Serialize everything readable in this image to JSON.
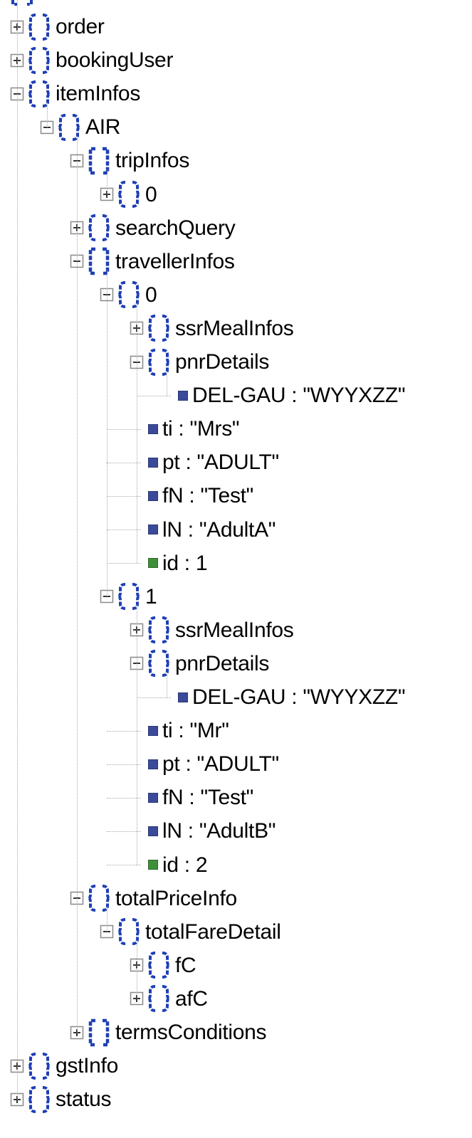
{
  "colors": {
    "bracket": "#1f3fb5",
    "string_leaf": "#3a4a9a",
    "number_leaf": "#3f8f3a",
    "toggle_border": "#8a8a8a",
    "guide_line": "#a9a9a9"
  },
  "nodes": [
    {
      "label": "order",
      "type": "object",
      "toggle": "plus",
      "depth": 0
    },
    {
      "label": "bookingUser",
      "type": "object",
      "toggle": "plus",
      "depth": 0
    },
    {
      "label": "itemInfos",
      "type": "object",
      "toggle": "minus",
      "depth": 0
    },
    {
      "label": "AIR",
      "type": "object",
      "toggle": "minus",
      "depth": 1
    },
    {
      "label": "tripInfos",
      "type": "array",
      "toggle": "minus",
      "depth": 2
    },
    {
      "label": "0",
      "type": "object",
      "toggle": "plus",
      "depth": 3
    },
    {
      "label": "searchQuery",
      "type": "object",
      "toggle": "plus",
      "depth": 2
    },
    {
      "label": "travellerInfos",
      "type": "array",
      "toggle": "minus",
      "depth": 2
    },
    {
      "label": "0",
      "type": "object",
      "toggle": "minus",
      "depth": 3
    },
    {
      "label": "ssrMealInfos",
      "type": "object",
      "toggle": "plus",
      "depth": 4
    },
    {
      "label": "pnrDetails",
      "type": "object",
      "toggle": "minus",
      "depth": 4
    },
    {
      "label": "DEL-GAU : \"WYYXZZ\"",
      "type": "string",
      "depth": 5
    },
    {
      "label": "ti : \"Mrs\"",
      "type": "string",
      "depth": 4
    },
    {
      "label": "pt : \"ADULT\"",
      "type": "string",
      "depth": 4
    },
    {
      "label": "fN : \"Test\"",
      "type": "string",
      "depth": 4
    },
    {
      "label": "lN : \"AdultA\"",
      "type": "string",
      "depth": 4
    },
    {
      "label": "id : 1",
      "type": "number",
      "depth": 4
    },
    {
      "label": "1",
      "type": "object",
      "toggle": "minus",
      "depth": 3
    },
    {
      "label": "ssrMealInfos",
      "type": "object",
      "toggle": "plus",
      "depth": 4
    },
    {
      "label": "pnrDetails",
      "type": "object",
      "toggle": "minus",
      "depth": 4
    },
    {
      "label": "DEL-GAU : \"WYYXZZ\"",
      "type": "string",
      "depth": 5
    },
    {
      "label": "ti : \"Mr\"",
      "type": "string",
      "depth": 4
    },
    {
      "label": "pt : \"ADULT\"",
      "type": "string",
      "depth": 4
    },
    {
      "label": "fN : \"Test\"",
      "type": "string",
      "depth": 4
    },
    {
      "label": "lN : \"AdultB\"",
      "type": "string",
      "depth": 4
    },
    {
      "label": "id : 2",
      "type": "number",
      "depth": 4
    },
    {
      "label": "totalPriceInfo",
      "type": "object",
      "toggle": "minus",
      "depth": 2
    },
    {
      "label": "totalFareDetail",
      "type": "object",
      "toggle": "minus",
      "depth": 3
    },
    {
      "label": "fC",
      "type": "object",
      "toggle": "plus",
      "depth": 4
    },
    {
      "label": "afC",
      "type": "object",
      "toggle": "plus",
      "depth": 4
    },
    {
      "label": "termsConditions",
      "type": "array",
      "toggle": "plus",
      "depth": 2
    },
    {
      "label": "gstInfo",
      "type": "object",
      "toggle": "plus",
      "depth": 0
    },
    {
      "label": "status",
      "type": "object",
      "toggle": "plus",
      "depth": 0
    }
  ]
}
